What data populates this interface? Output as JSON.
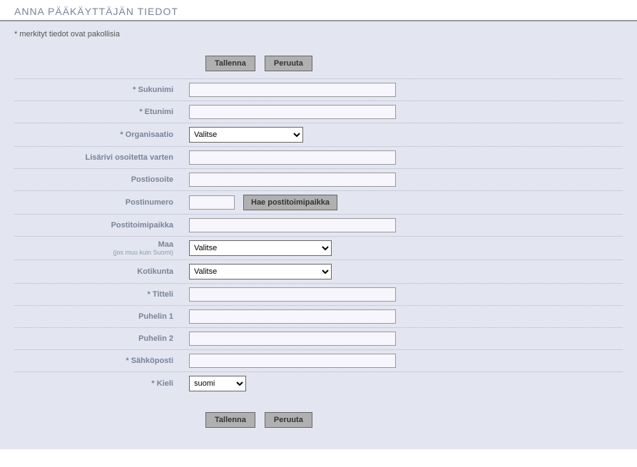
{
  "pageTitle": "ANNA PÄÄKÄYTTÄJÄN TIEDOT",
  "requiredNote": "* merkityt tiedot ovat pakollisia",
  "buttons": {
    "save": "Tallenna",
    "cancel": "Peruuta",
    "lookupPostal": "Hae postitoimipaikka"
  },
  "labels": {
    "lastName": "* Sukunimi",
    "firstName": "* Etunimi",
    "organization": "* Organisaatio",
    "addressExtra": "Lisärivi osoitetta varten",
    "postalAddress": "Postiosoite",
    "postalCode": "Postinumero",
    "postalCity": "Postitoimipaikka",
    "country": "Maa",
    "countrySub": "(jos muu kuin Suomi)",
    "homeMunicipality": "Kotikunta",
    "title": "* Titteli",
    "phone1": "Puhelin 1",
    "phone2": "Puhelin 2",
    "email": "* Sähköposti",
    "language": "* Kieli"
  },
  "values": {
    "lastName": "",
    "firstName": "",
    "organization": "Valitse",
    "addressExtra": "",
    "postalAddress": "",
    "postalCode": "",
    "postalCity": "",
    "country": "Valitse",
    "homeMunicipality": "Valitse",
    "title": "",
    "phone1": "",
    "phone2": "",
    "email": "",
    "language": "suomi"
  }
}
